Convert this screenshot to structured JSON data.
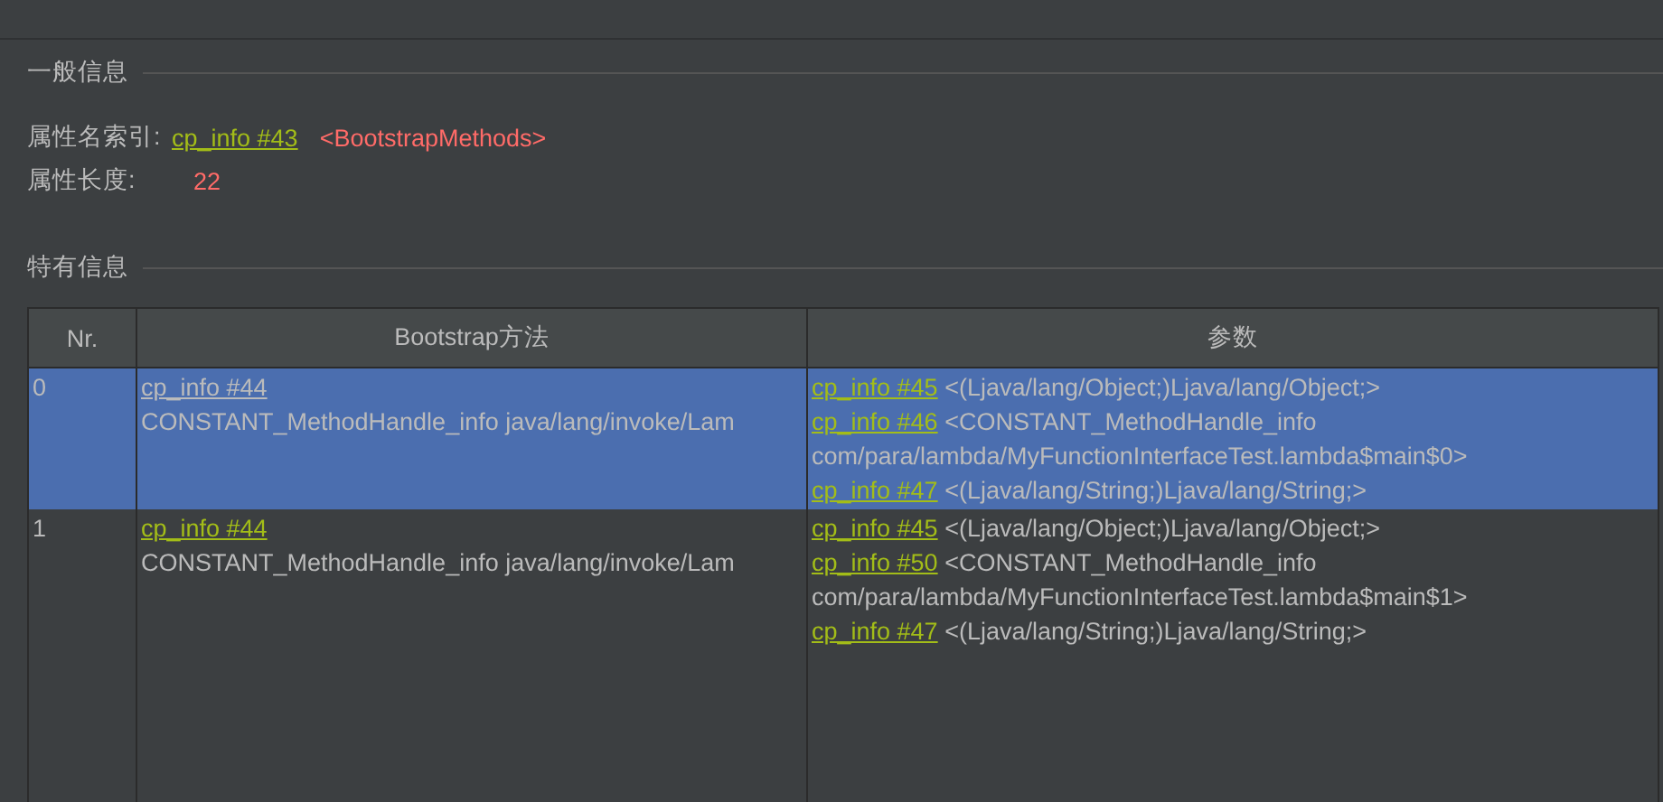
{
  "general": {
    "title": "一般信息",
    "fields": [
      {
        "label": "属性名索引:",
        "link": "cp_info #43",
        "value": "<BootstrapMethods>"
      },
      {
        "label": "属性长度:",
        "value": "22"
      }
    ]
  },
  "specific": {
    "title": "特有信息"
  },
  "table": {
    "columns": [
      "Nr.",
      "Bootstrap方法",
      "参数"
    ],
    "rows": [
      {
        "selected": true,
        "nr": "0",
        "method": {
          "link": "cp_info #44",
          "text": "CONSTANT_MethodHandle_info java/lang/invoke/Lam"
        },
        "args": [
          {
            "link": "cp_info #45",
            "text": "<(Ljava/lang/Object;)Ljava/lang/Object;>"
          },
          {
            "link": "cp_info #46",
            "text": "<CONSTANT_MethodHandle_info",
            "continuation": "com/para/lambda/MyFunctionInterfaceTest.lambda$main$0>"
          },
          {
            "link": "cp_info #47",
            "text": "<(Ljava/lang/String;)Ljava/lang/String;>"
          }
        ]
      },
      {
        "selected": false,
        "nr": "1",
        "method": {
          "link": "cp_info #44",
          "text": "CONSTANT_MethodHandle_info java/lang/invoke/Lam"
        },
        "args": [
          {
            "link": "cp_info #45",
            "text": "<(Ljava/lang/Object;)Ljava/lang/Object;>"
          },
          {
            "link": "cp_info #50",
            "text": "<CONSTANT_MethodHandle_info",
            "continuation": "com/para/lambda/MyFunctionInterfaceTest.lambda$main$1>"
          },
          {
            "link": "cp_info #47",
            "text": "<(Ljava/lang/String;)Ljava/lang/String;>"
          }
        ]
      }
    ]
  }
}
